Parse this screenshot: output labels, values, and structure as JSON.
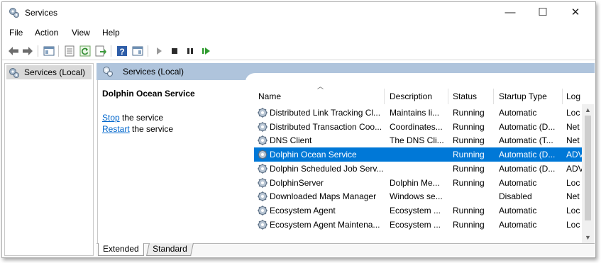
{
  "window": {
    "title": "Services"
  },
  "window_controls": {
    "minimize": "—",
    "maximize": "☐",
    "close": "✕"
  },
  "menu": [
    "File",
    "Action",
    "View",
    "Help"
  ],
  "toolbar_icons": [
    "back-icon",
    "forward-icon",
    "show-hide-tree-icon",
    "properties-icon",
    "refresh-icon",
    "export-list-icon",
    "help-icon",
    "action-pane-icon",
    "start-service-icon",
    "stop-service-icon",
    "pause-service-icon",
    "resume-service-icon"
  ],
  "tree": {
    "selected_item": "Services (Local)"
  },
  "content_header": {
    "title": "Services (Local)"
  },
  "description": {
    "service_name": "Dolphin Ocean Service",
    "stop_link": "Stop",
    "stop_rest": " the service",
    "restart_link": "Restart",
    "restart_rest": " the service"
  },
  "columns": [
    "Name",
    "Description",
    "Status",
    "Startup Type",
    "Log"
  ],
  "rows": [
    {
      "name": "Distributed Link Tracking Cl...",
      "description": "Maintains li...",
      "status": "Running",
      "startup": "Automatic",
      "log": "Loc"
    },
    {
      "name": "Distributed Transaction Coo...",
      "description": "Coordinates...",
      "status": "Running",
      "startup": "Automatic (D...",
      "log": "Net"
    },
    {
      "name": "DNS Client",
      "description": "The DNS Cli...",
      "status": "Running",
      "startup": "Automatic (T...",
      "log": "Net"
    },
    {
      "name": "Dolphin Ocean Service",
      "description": "",
      "status": "Running",
      "startup": "Automatic (D...",
      "log": "ADV"
    },
    {
      "name": "Dolphin Scheduled Job Serv...",
      "description": "",
      "status": "Running",
      "startup": "Automatic (D...",
      "log": "ADV"
    },
    {
      "name": "DolphinServer",
      "description": "Dolphin Me...",
      "status": "Running",
      "startup": "Automatic",
      "log": "Loc"
    },
    {
      "name": "Downloaded Maps Manager",
      "description": "Windows se...",
      "status": "",
      "startup": "Disabled",
      "log": "Net"
    },
    {
      "name": "Ecosystem Agent",
      "description": "Ecosystem ...",
      "status": "Running",
      "startup": "Automatic",
      "log": "Loc"
    },
    {
      "name": "Ecosystem Agent Maintena...",
      "description": "Ecosystem ...",
      "status": "Running",
      "startup": "Automatic",
      "log": "Loc"
    }
  ],
  "selected_row": 3,
  "tabs": [
    "Extended",
    "Standard"
  ],
  "colors": {
    "selection": "#0078d7",
    "header_band": "#afc4dc",
    "link": "#0066cc"
  }
}
